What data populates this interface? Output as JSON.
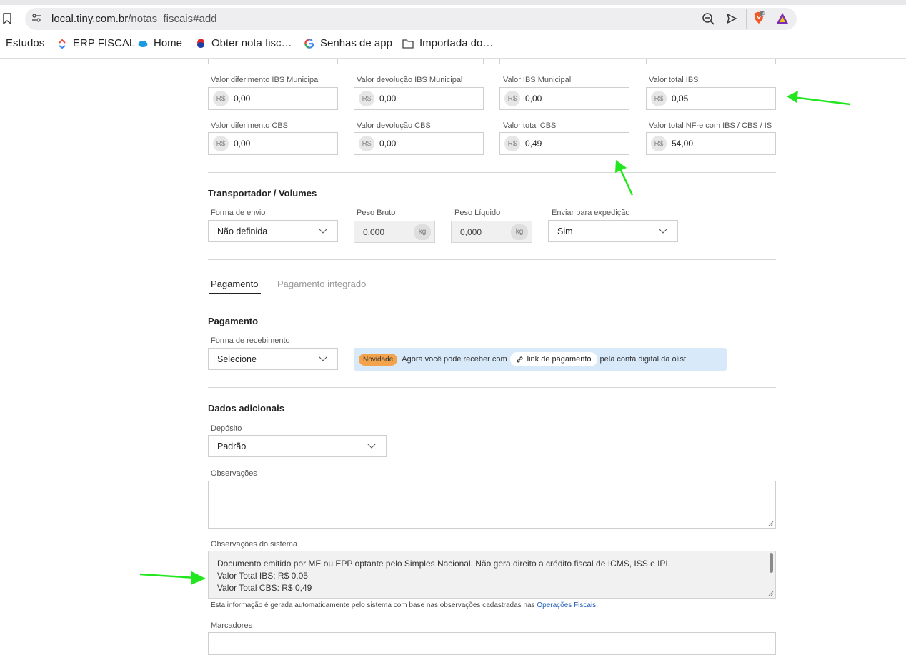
{
  "browser": {
    "url_host": "local.tiny.com.br",
    "url_path": "/notas_fiscais#add",
    "extension_badge": "4",
    "bookmarks": [
      {
        "label": "Estudos",
        "icon": "none"
      },
      {
        "label": "ERP FISCAL",
        "icon": "erp-icon"
      },
      {
        "label": "Home",
        "icon": "cloud-icon"
      },
      {
        "label": "Obter nota fisc…",
        "icon": "drop-icon"
      },
      {
        "label": "Senhas de app",
        "icon": "google-icon"
      },
      {
        "label": "Importada do…",
        "icon": "folder-icon"
      }
    ]
  },
  "taxes": {
    "currency": "R$",
    "row1": [
      {
        "label": "Valor diferimento IBS Municipal",
        "value": "0,00"
      },
      {
        "label": "Valor devolução IBS Municipal",
        "value": "0,00"
      },
      {
        "label": "Valor IBS Municipal",
        "value": "0,00"
      },
      {
        "label": "Valor total IBS",
        "value": "0,05"
      }
    ],
    "row2": [
      {
        "label": "Valor diferimento CBS",
        "value": "0,00"
      },
      {
        "label": "Valor devolução CBS",
        "value": "0,00"
      },
      {
        "label": "Valor total CBS",
        "value": "0,49"
      },
      {
        "label": "Valor total NF-e com IBS / CBS / IS",
        "value": "54,00"
      }
    ]
  },
  "transport": {
    "title": "Transportador / Volumes",
    "shipping_label": "Forma de envio",
    "shipping_value": "Não definida",
    "gross_label": "Peso Bruto",
    "gross_value": "0,000",
    "net_label": "Peso Líquido",
    "net_value": "0,000",
    "unit": "kg",
    "dispatch_label": "Enviar para expedição",
    "dispatch_value": "Sim"
  },
  "payment": {
    "tabs": [
      "Pagamento",
      "Pagamento integrado"
    ],
    "title": "Pagamento",
    "method_label": "Forma de recebimento",
    "method_value": "Selecione",
    "banner_badge": "Novidade",
    "banner_text_before": "Agora você pode receber com",
    "banner_link": "link de pagamento",
    "banner_text_after": "pela conta digital da olist"
  },
  "additional": {
    "title": "Dados adicionais",
    "deposit_label": "Depósito",
    "deposit_value": "Padrão",
    "obs_label": "Observações",
    "sys_obs_label": "Observações do sistema",
    "sys_obs_lines": [
      "Documento emitido por ME ou EPP optante pelo Simples Nacional. Não gera direito a crédito fiscal de ICMS, ISS e IPI.",
      "Valor Total IBS: R$ 0,05",
      "Valor Total CBS: R$ 0,49"
    ],
    "info_text": "Esta informação é gerada automaticamente pelo sistema com base nas observações cadastradas nas",
    "info_link": "Operações Fiscais",
    "info_end": ".",
    "tags_label": "Marcadores"
  },
  "colors": {
    "arrow": "#22e61e",
    "badge": "#f3a34c",
    "banner": "#d8e9fa",
    "link": "#1f5bb6"
  }
}
